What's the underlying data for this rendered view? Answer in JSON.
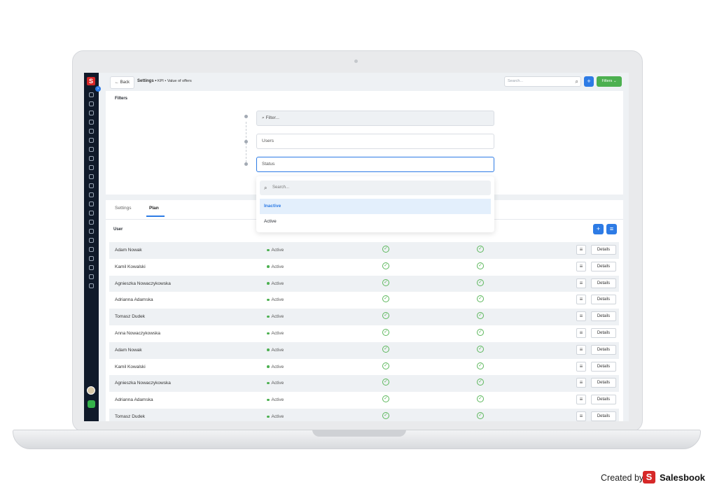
{
  "topbar": {
    "back_label": "Back",
    "breadcrumb_main": "Settings •",
    "breadcrumb_rest": "KPI • Value of offers",
    "search_placeholder": "Search...",
    "add_label": "+",
    "filters_label": "Filters ⌄"
  },
  "filters": {
    "title": "Filters",
    "filter_placeholder": "Filter...",
    "users_label": "Users",
    "status_label": "Status",
    "dropdown": {
      "search_placeholder": "Search...",
      "options": [
        "Inactive",
        "Active"
      ],
      "selected": "Inactive"
    }
  },
  "tabs": [
    {
      "label": "Settings",
      "active": false
    },
    {
      "label": "Plan",
      "active": true
    }
  ],
  "table": {
    "user_header": "User",
    "details_label": "Details",
    "rows": [
      {
        "name": "Adam Nowak",
        "status": "Active"
      },
      {
        "name": "Kamil Kowalski",
        "status": "Active"
      },
      {
        "name": "Agnieszka Nowaczykowska",
        "status": "Active"
      },
      {
        "name": "Adrianna Adamska",
        "status": "Active"
      },
      {
        "name": "Tomasz Dudek",
        "status": "Active"
      },
      {
        "name": "Anna Nowaczykowska",
        "status": "Active"
      },
      {
        "name": "Adam Nowak",
        "status": "Active"
      },
      {
        "name": "Kamil Kowalski",
        "status": "Active"
      },
      {
        "name": "Agnieszka Nowaczykowska",
        "status": "Active"
      },
      {
        "name": "Adrianna Adamska",
        "status": "Active"
      },
      {
        "name": "Tomasz Dudek",
        "status": "Active"
      }
    ]
  },
  "credit": {
    "prefix": "Created by",
    "brand": "Salesbook",
    "logo_letter": "S"
  },
  "colors": {
    "accent": "#2d7be5",
    "green": "#4cb050",
    "sidebar": "#101a2a",
    "brand_red": "#d62828"
  }
}
